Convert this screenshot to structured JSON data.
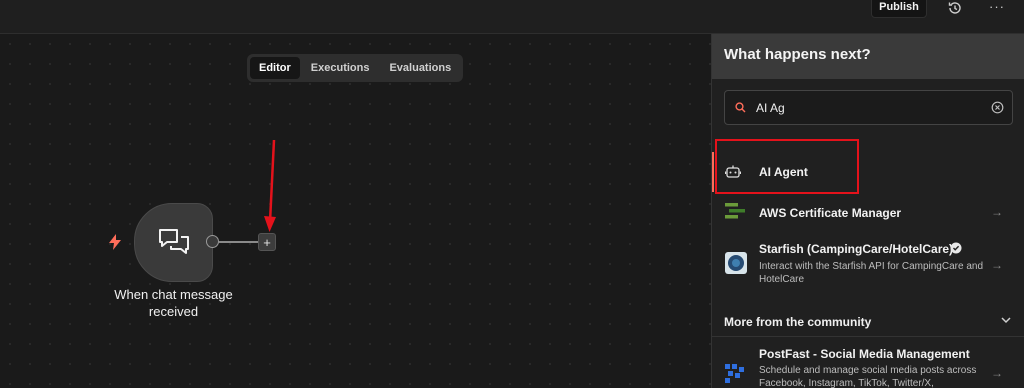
{
  "topbar": {
    "publish_label": "Publish",
    "history_icon": "history-icon",
    "more_label": "···"
  },
  "editor_tabs": [
    {
      "label": "Editor",
      "active": true
    },
    {
      "label": "Executions",
      "active": false
    },
    {
      "label": "Evaluations",
      "active": false
    }
  ],
  "canvas": {
    "trigger_node": {
      "label": "When chat message received",
      "icon": "chat-bubbles-icon",
      "trigger_icon": "lightning-bolt-icon"
    },
    "add_button_label": "+"
  },
  "panel": {
    "title": "What happens next?",
    "search": {
      "value": "AI Ag",
      "icon": "search-icon",
      "clear_icon": "clear-icon"
    },
    "results": [
      {
        "title": "AI Agent",
        "description": "",
        "icon": "robot-icon",
        "highlighted": true
      },
      {
        "title": "AWS Certificate Manager",
        "description": "",
        "icon": "aws-certificate-manager-icon"
      },
      {
        "title": "Starfish (CampingCare/HotelCare)",
        "description": "Interact with the Starfish API for CampingCare and HotelCare",
        "icon": "starfish-icon",
        "verified": true
      }
    ],
    "community_section": {
      "title": "More from the community",
      "items": [
        {
          "title": "PostFast - Social Media Management",
          "description": "Schedule and manage social media posts across Facebook, Instagram, TikTok, Twitter/X,",
          "icon": "postfast-icon"
        }
      ]
    }
  },
  "colors": {
    "accent": "#ff6d5a",
    "annotation_red": "#e4121b",
    "panel_header": "#3a3a3a"
  }
}
